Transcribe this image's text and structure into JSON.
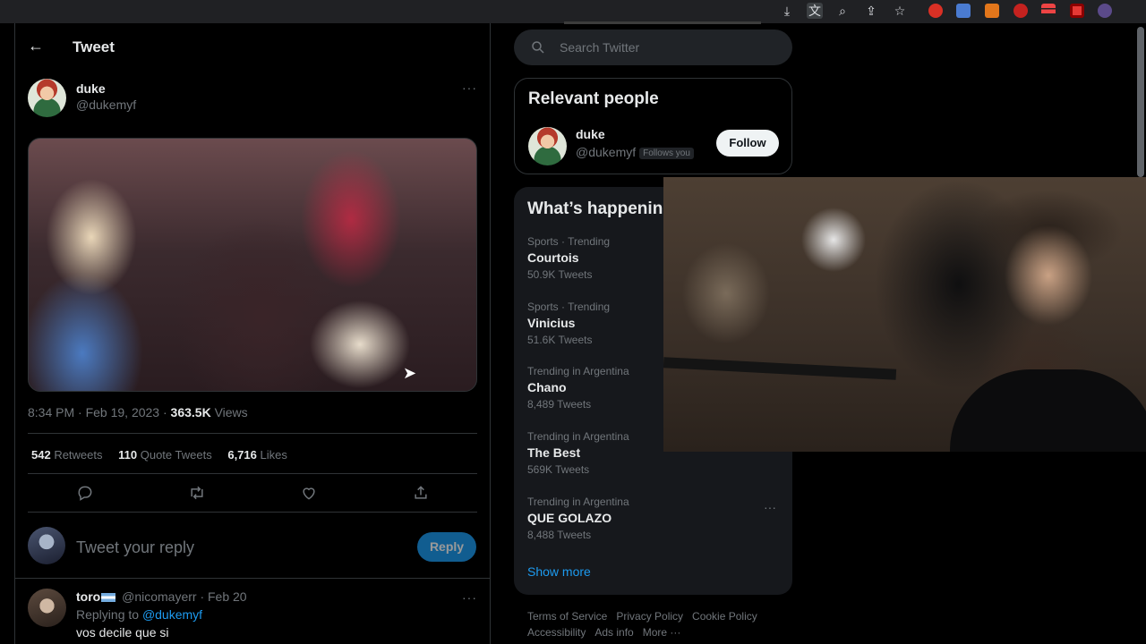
{
  "browser": {
    "icons": [
      "download-icon",
      "translate-icon",
      "zoom-icon",
      "share-icon",
      "bookmark-star-icon"
    ],
    "extensions": [
      "extension-1",
      "extension-2",
      "extension-3",
      "extension-4",
      "extension-5",
      "extension-6",
      "extension-7"
    ]
  },
  "header": {
    "title": "Tweet"
  },
  "tweet": {
    "author_name": "duke",
    "author_handle": "@dukemyf",
    "time": "8:34 PM · Feb 19, 2023 · ",
    "views_count": "363.5K",
    "views_label": " Views",
    "retweets_count": "542",
    "retweets_label": " Retweets",
    "quotes_count": "110",
    "quotes_label": " Quote Tweets",
    "likes_count": "6,716",
    "likes_label": " Likes",
    "more": "···"
  },
  "reply_box": {
    "placeholder": "Tweet your reply",
    "button": "Reply"
  },
  "reply": {
    "name": "toro",
    "handle_time": " @nicomayerr · Feb 20",
    "replying_prefix": "Replying to ",
    "replying_handle": "@dukemyf",
    "text": "vos decile que si",
    "more": "···"
  },
  "search": {
    "placeholder": "Search Twitter"
  },
  "relevant_people": {
    "title": "Relevant people",
    "name": "duke",
    "handle": "@dukemyf",
    "follows_you": "Follows you",
    "follow_button": "Follow"
  },
  "trends": {
    "title": "What’s happening",
    "items": [
      {
        "context": "Sports · Trending",
        "name": "Courtois",
        "count": "50.9K Tweets"
      },
      {
        "context": "Sports · Trending",
        "name": "Vinicius",
        "count": "51.6K Tweets"
      },
      {
        "context": "Trending in Argentina",
        "name": "Chano",
        "count": "8,489 Tweets"
      },
      {
        "context": "Trending in Argentina",
        "name": "The Best",
        "count": "569K Tweets"
      },
      {
        "context": "Trending in Argentina",
        "name": "QUE GOLAZO",
        "count": "8,488 Tweets"
      }
    ],
    "more": "···",
    "show_more": "Show more"
  },
  "footer": {
    "links": [
      "Terms of Service",
      "Privacy Policy",
      "Cookie Policy",
      "Accessibility",
      "Ads info",
      "More ···"
    ]
  },
  "colors": {
    "accent": "#1d9bf0",
    "background": "#000000",
    "muted": "#71767b"
  }
}
